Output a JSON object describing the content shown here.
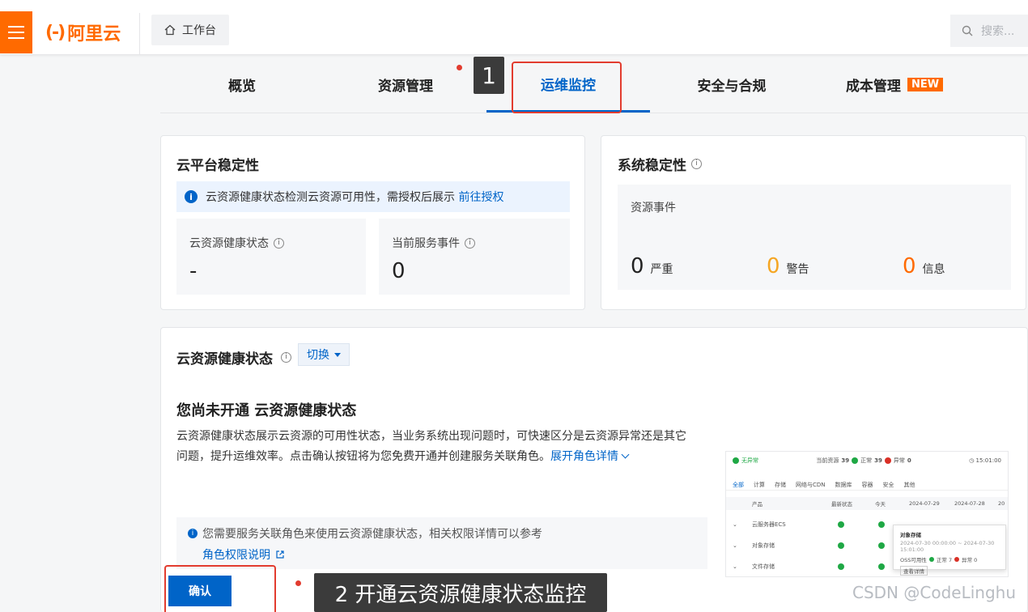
{
  "header": {
    "logo_text": "阿里云",
    "logo_bracket": "(-)",
    "workbench_label": "工作台",
    "search_placeholder": "搜索..."
  },
  "tabs": [
    {
      "label": "概览"
    },
    {
      "label": "资源管理"
    },
    {
      "label": "运维监控"
    },
    {
      "label": "安全与合规"
    },
    {
      "label": "成本管理",
      "badge": "NEW"
    }
  ],
  "callouts": {
    "step1": "1",
    "step2": "2 开通云资源健康状态监控"
  },
  "platform_card": {
    "title": "云平台稳定性",
    "notice_text": "云资源健康状态检测云资源可用性，需授权后展示",
    "notice_link": "前往授权",
    "stats": [
      {
        "label": "云资源健康状态",
        "value": "-"
      },
      {
        "label": "当前服务事件",
        "value": "0"
      }
    ]
  },
  "system_card": {
    "title": "系统稳定性",
    "subtitle": "资源事件",
    "counts": [
      {
        "value": "0",
        "label": "严重",
        "color": "#222222"
      },
      {
        "value": "0",
        "label": "警告",
        "color": "#f5a623"
      },
      {
        "value": "0",
        "label": "信息",
        "color": "#ff6a00"
      }
    ]
  },
  "health_card": {
    "title": "云资源健康状态",
    "switch_label": "切换",
    "heading": "您尚未开通 云资源健康状态",
    "desc_line1": "云资源健康状态展示云资源的可用性状态，当业务系统出现问题时，可快速区分是云资源异常还是其它",
    "desc_line2": "问题，提升运维效率。点击确认按钮将为您免费开通并创建服务关联角色。",
    "expand_link": "展开角色详情",
    "role_notice": "您需要服务关联角色来使用云资源健康状态，相关权限详情可以参考",
    "role_link": "角色权限说明",
    "confirm_label": "确认"
  },
  "preview": {
    "status": "无异常",
    "summary_prefix": "当前资源",
    "total": "39",
    "ok_label": "正常",
    "ok": "39",
    "err_label": "异常",
    "err": "0",
    "time": "15:01:00",
    "filters": [
      "全部",
      "计算",
      "存储",
      "网络与CDN",
      "数据库",
      "容器",
      "安全",
      "其他"
    ],
    "columns": [
      "产品",
      "最新状态",
      "今天",
      "2024-07-29",
      "2024-07-28",
      "20"
    ],
    "rows": [
      "云服务器ECS",
      "对象存储",
      "文件存储"
    ],
    "popup_title": "对象存储",
    "popup_range": "2024-07-30 00:00:00 ~ 2024-07-30 15:01:00",
    "popup_metric": "OSS可用性",
    "popup_ok": "正常 7",
    "popup_err": "异常 0",
    "popup_btn": "查看详情"
  },
  "watermark": "CSDN @CodeLinghu"
}
